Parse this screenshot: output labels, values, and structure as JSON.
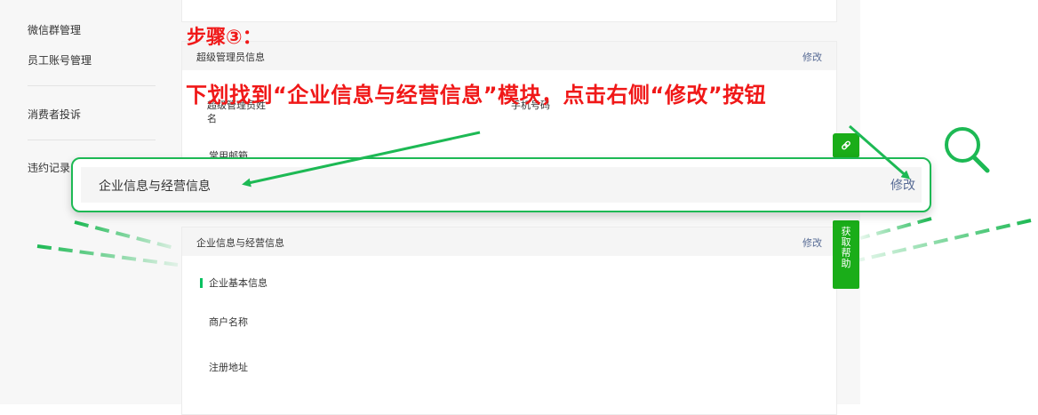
{
  "sidebar": {
    "items": [
      {
        "label": "微信群管理"
      },
      {
        "label": "员工账号管理"
      },
      {
        "label": "消费者投诉"
      },
      {
        "label": "违约记录"
      }
    ]
  },
  "admin_card": {
    "title": "超级管理员信息",
    "edit_label": "修改",
    "fields": [
      "超级管理员姓名",
      "手机号码",
      "常用邮箱"
    ]
  },
  "business_card": {
    "title": "企业信息与经营信息",
    "edit_label": "修改",
    "section_title": "企业基本信息",
    "fields": [
      "商户名称",
      "注册地址"
    ]
  },
  "help_button": {
    "chars": [
      "获",
      "取",
      "帮",
      "助"
    ]
  },
  "tutorial": {
    "step_title": "步骤③：",
    "instruction": "下划找到“企业信息与经营信息”模块，点击右侧“修改”按钮"
  },
  "zoom_callout": {
    "title": "企业信息与经营信息",
    "edit_label": "修改"
  },
  "colors": {
    "accent_green": "#1aad19",
    "link_blue": "#576b95",
    "annotation_red": "#f01818"
  },
  "icons": [
    "link-icon",
    "search-icon"
  ]
}
